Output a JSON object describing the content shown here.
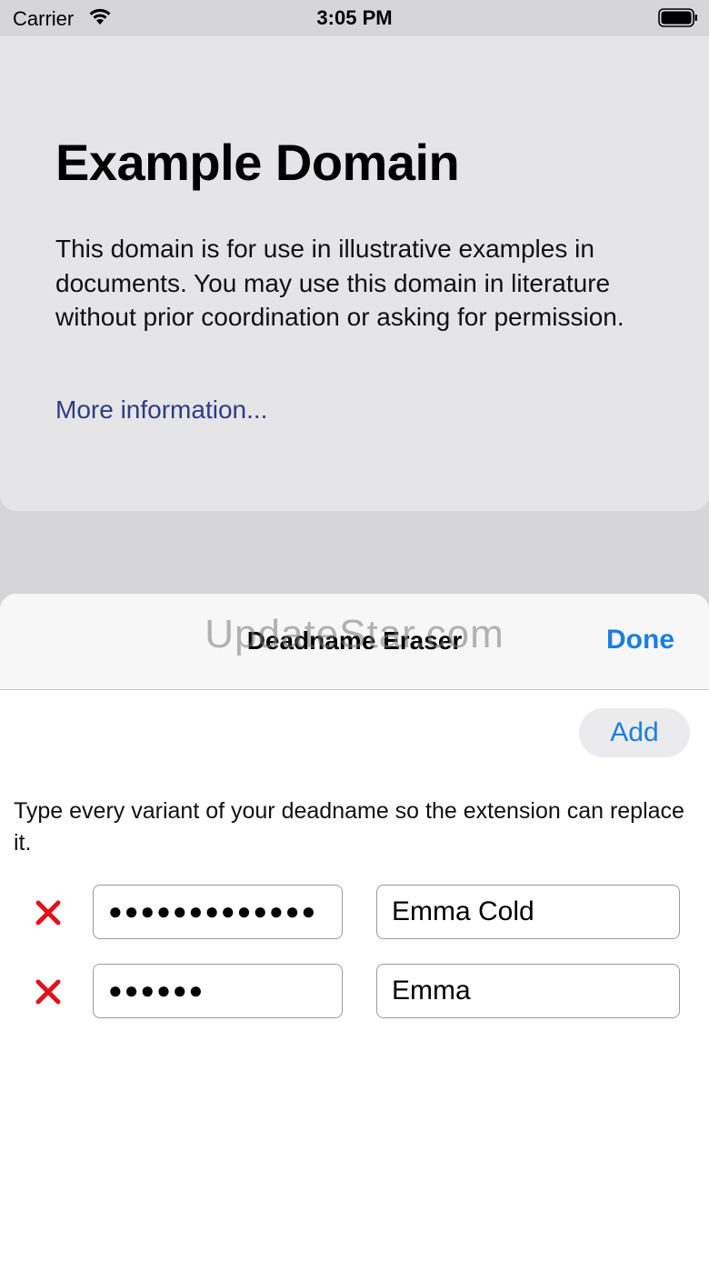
{
  "status_bar": {
    "carrier": "Carrier",
    "time": "3:05 PM",
    "icons": [
      "wifi-icon",
      "battery-icon"
    ]
  },
  "web_page": {
    "title": "Example Domain",
    "body": "This domain is for use in illustrative examples in documents. You may use this domain in literature without prior coordination or asking for permission.",
    "link": "More information..."
  },
  "sheet": {
    "title": "Deadname Eraser",
    "watermark": "UpdateStar.com",
    "done_label": "Done",
    "add_label": "Add",
    "instructions": "Type every variant of your deadname so the extension can replace it.",
    "entries": [
      {
        "deadname": "●●●●●●●●●●●●●",
        "replacement": "Emma Cold"
      },
      {
        "deadname": "●●●●●●",
        "replacement": "Emma"
      }
    ]
  },
  "colors": {
    "accent": "#1a7fe0",
    "remove": "#e0121b",
    "link": "#2f3c80"
  }
}
